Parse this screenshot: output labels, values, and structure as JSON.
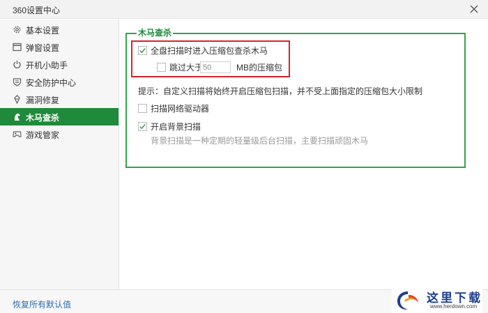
{
  "window": {
    "title": "360设置中心"
  },
  "sidebar": {
    "items": [
      {
        "label": "基本设置",
        "icon": "gear-icon"
      },
      {
        "label": "弹窗设置",
        "icon": "window-icon"
      },
      {
        "label": "开机小助手",
        "icon": "power-icon"
      },
      {
        "label": "安全防护中心",
        "icon": "shield-icon"
      },
      {
        "label": "漏洞修复",
        "icon": "bandage-icon"
      },
      {
        "label": "木马查杀",
        "icon": "horse-icon",
        "active": true
      },
      {
        "label": "游戏管家",
        "icon": "gamepad-icon"
      }
    ]
  },
  "main": {
    "group_title": "木马查杀",
    "options": {
      "scan_archives": {
        "label": "全盘扫描时进入压缩包查杀木马",
        "checked": true
      },
      "skip_larger": {
        "prefix": "跳过大于",
        "value": "50",
        "suffix": "MB的压缩包",
        "checked": false
      },
      "tip": "提示：自定义扫描将始终开启压缩包扫描，并不受上面指定的压缩包大小限制",
      "scan_network_drives": {
        "label": "扫描网络驱动器",
        "checked": false
      },
      "background_scan": {
        "label": "开启背景扫描",
        "checked": true,
        "description": "背景扫描是一种定期的轻量级后台扫描，主要扫描顽固木马"
      }
    }
  },
  "footer": {
    "restore_label": "恢复所有默认值"
  },
  "watermark": {
    "cn": "这里下载",
    "en": "www.herdown.com"
  },
  "colors": {
    "accent_green": "#1f8a3b",
    "highlight_red": "#d9232a",
    "link_blue": "#2d6db5"
  }
}
